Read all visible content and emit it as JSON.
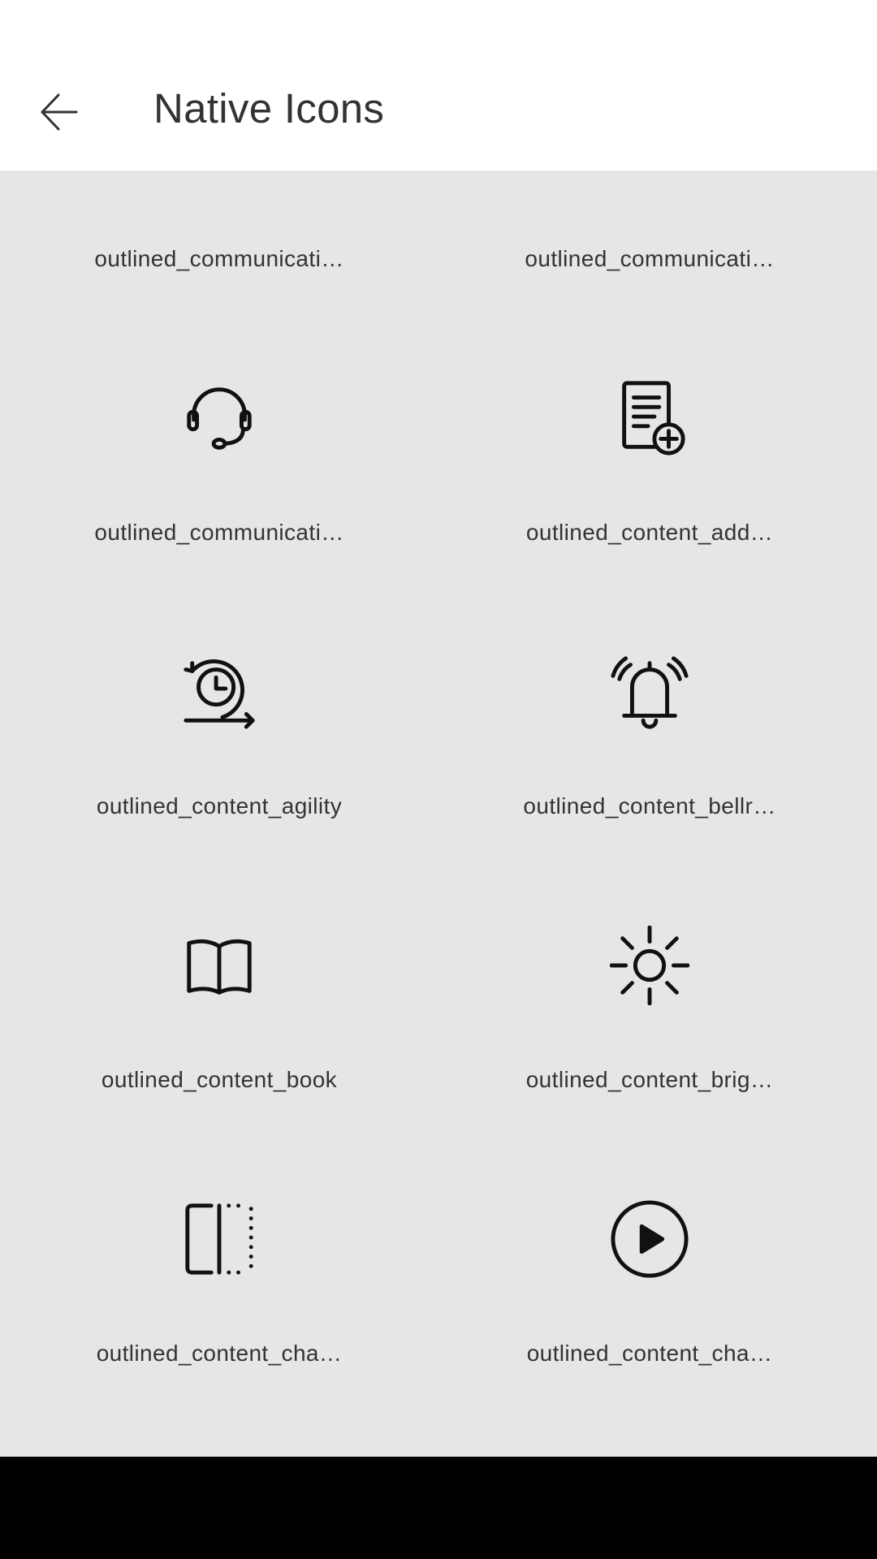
{
  "app_bar": {
    "title": "Native Icons",
    "back_icon": "arrow-left-icon"
  },
  "grid": {
    "items": [
      {
        "label": "outlined_communicati…",
        "icon": "antenna-icon"
      },
      {
        "label": "outlined_communicati…",
        "icon": "communication-icon"
      },
      {
        "label": "outlined_communicati…",
        "icon": "headset-icon"
      },
      {
        "label": "outlined_content_add…",
        "icon": "document-add-icon"
      },
      {
        "label": "outlined_content_agility",
        "icon": "agility-icon"
      },
      {
        "label": "outlined_content_bellr…",
        "icon": "bell-ringing-icon"
      },
      {
        "label": "outlined_content_book",
        "icon": "book-icon"
      },
      {
        "label": "outlined_content_brig…",
        "icon": "brightness-icon"
      },
      {
        "label": "outlined_content_cha…",
        "icon": "panel-dotted-icon"
      },
      {
        "label": "outlined_content_cha…",
        "icon": "play-circle-icon"
      }
    ]
  },
  "colors": {
    "background": "#e6e6e6",
    "app_bar": "#ffffff",
    "text": "#333333",
    "nav_bar": "#000000"
  }
}
